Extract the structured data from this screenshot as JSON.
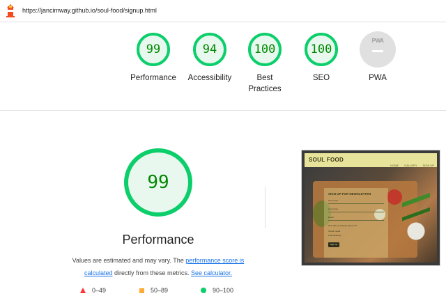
{
  "browser": {
    "url": "https://jancimway.github.io/soul-food/signup.html"
  },
  "summary_gauges": [
    {
      "score": "99",
      "label": "Performance"
    },
    {
      "score": "94",
      "label": "Accessibility"
    },
    {
      "score": "100",
      "label": "Best Practices"
    },
    {
      "score": "100",
      "label": "SEO"
    },
    {
      "score": "PWA",
      "label": "PWA"
    }
  ],
  "performance": {
    "score": "99",
    "title": "Performance",
    "desc_text1": "Values are estimated and may vary. The ",
    "desc_link1": "performance score is calculated",
    "desc_text2": " directly from these metrics. ",
    "desc_link2": "See calculator."
  },
  "legend": [
    {
      "range": "0–49",
      "color": "#ff3333",
      "shape": "triangle"
    },
    {
      "range": "50–89",
      "color": "#ffaa33",
      "shape": "square"
    },
    {
      "range": "90–100",
      "color": "#0cce6b",
      "shape": "circle"
    }
  ],
  "screenshot": {
    "brand": "SOUL FOOD",
    "nav": [
      "HOME",
      "GALLERY",
      "SIGN UP"
    ],
    "newsletter_title": "SIGN UP FOR NEWSLETTER",
    "fields": [
      "First name",
      "Last name",
      "Email"
    ],
    "prompt": "How did you find out about us?",
    "options": [
      "Social media",
      "Friends/family"
    ],
    "submit": "Sign up"
  },
  "colors": {
    "pass_green": "#0cce6b",
    "pass_text": "#008800",
    "link_blue": "#1a73e8"
  }
}
